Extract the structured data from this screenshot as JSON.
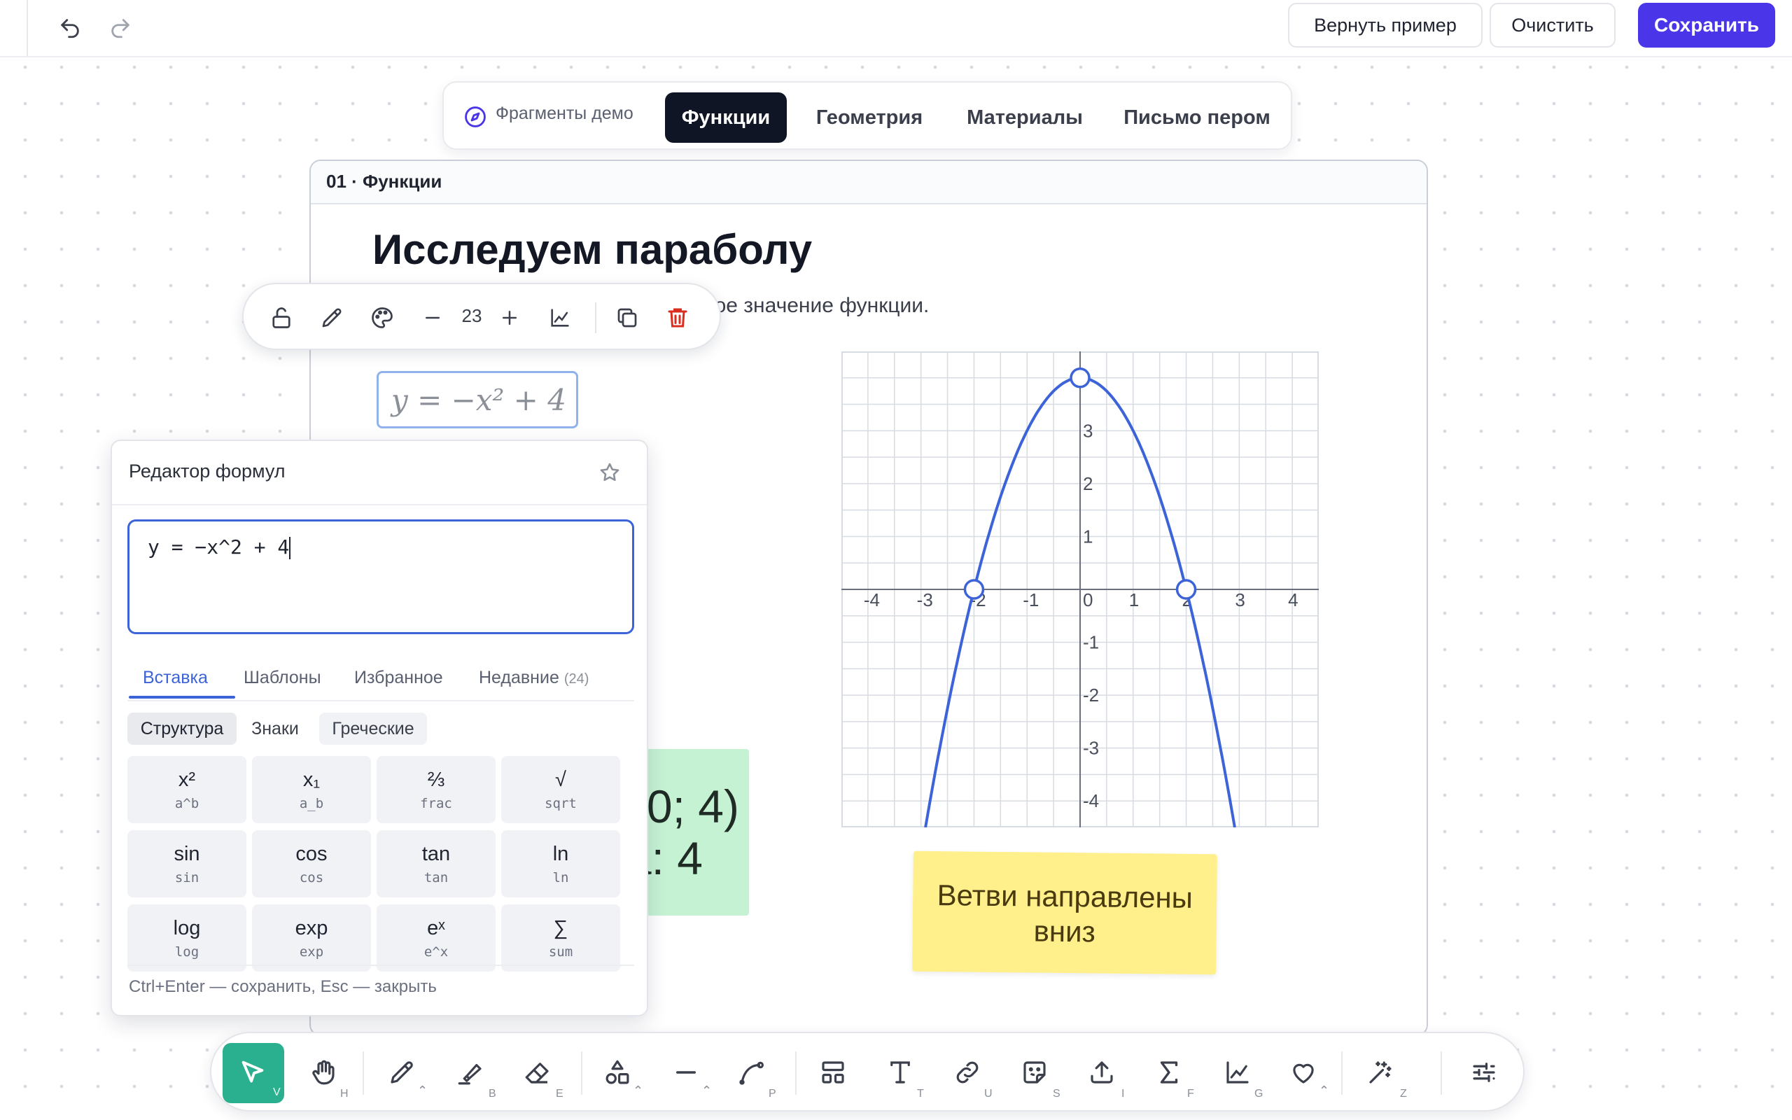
{
  "header": {
    "restore_label": "Вернуть пример",
    "clear_label": "Очистить",
    "save_label": "Сохранить"
  },
  "fragments": {
    "demo_label": "Фрагменты демо",
    "tabs": [
      "Функции",
      "Геометрия",
      "Материалы",
      "Письмо пером"
    ],
    "active": "Функции"
  },
  "card": {
    "header": "01 · Функции",
    "title": "Исследуем параболу",
    "subtitle_visible": "ное значение функции."
  },
  "floating_toolbar": {
    "size_value": "23"
  },
  "formula_preview": "y = −x² + 4",
  "editor": {
    "title": "Редактор формул",
    "input_value": "y = −x^2 + 4",
    "tabs": [
      "Вставка",
      "Шаблоны",
      "Избранное",
      "Недавние"
    ],
    "recent_count": "(24)",
    "active_tab": "Вставка",
    "categories": [
      "Структура",
      "Знаки",
      "Греческие"
    ],
    "active_category": "Структура",
    "buttons": [
      {
        "main": "x²",
        "sub": "a^b"
      },
      {
        "main": "x₁",
        "sub": "a_b"
      },
      {
        "main": "⅔",
        "sub": "frac"
      },
      {
        "main": "√",
        "sub": "sqrt"
      },
      {
        "main": "sin",
        "sub": "sin"
      },
      {
        "main": "cos",
        "sub": "cos"
      },
      {
        "main": "tan",
        "sub": "tan"
      },
      {
        "main": "ln",
        "sub": "ln"
      },
      {
        "main": "log",
        "sub": "log"
      },
      {
        "main": "exp",
        "sub": "exp"
      },
      {
        "main": "eˣ",
        "sub": "e^x"
      },
      {
        "main": "∑",
        "sub": "sum"
      }
    ],
    "hint": "Ctrl+Enter — сохранить, Esc — закрыть"
  },
  "green_note": {
    "line1": "0; 4)",
    "line2": "а: 4"
  },
  "yellow_note": {
    "line1": "Ветви направлены",
    "line2": "вниз"
  },
  "chart_data": {
    "type": "line",
    "function": "y = -x^2 + 4",
    "xlim": [
      -4.5,
      4.5
    ],
    "ylim": [
      -4.5,
      4.5
    ],
    "grid": true,
    "x_ticks": [
      -4,
      -3,
      -2,
      -1,
      0,
      1,
      2,
      3,
      4
    ],
    "y_ticks": [
      -4,
      -3,
      -2,
      -1,
      1,
      2,
      3
    ],
    "marked_points": [
      {
        "x": -2,
        "y": 0
      },
      {
        "x": 0,
        "y": 4
      },
      {
        "x": 2,
        "y": 0
      }
    ],
    "colors": {
      "curve": "#3d63d8",
      "grid": "#d7dbe2",
      "axis": "#6b7080"
    }
  },
  "bottom_toolbar": {
    "keys": [
      "V",
      "H",
      "B",
      "E",
      "P",
      "T",
      "U",
      "S",
      "I",
      "F",
      "G",
      "Z"
    ]
  },
  "colors": {
    "accent": "#4a36e8",
    "active_tab": "#101525",
    "editor_focus": "#3d63d8",
    "delete": "#d92d20",
    "select_tool": "#2bb08f",
    "green_note": "#c6f2d4",
    "yellow_note": "#fff08c"
  }
}
